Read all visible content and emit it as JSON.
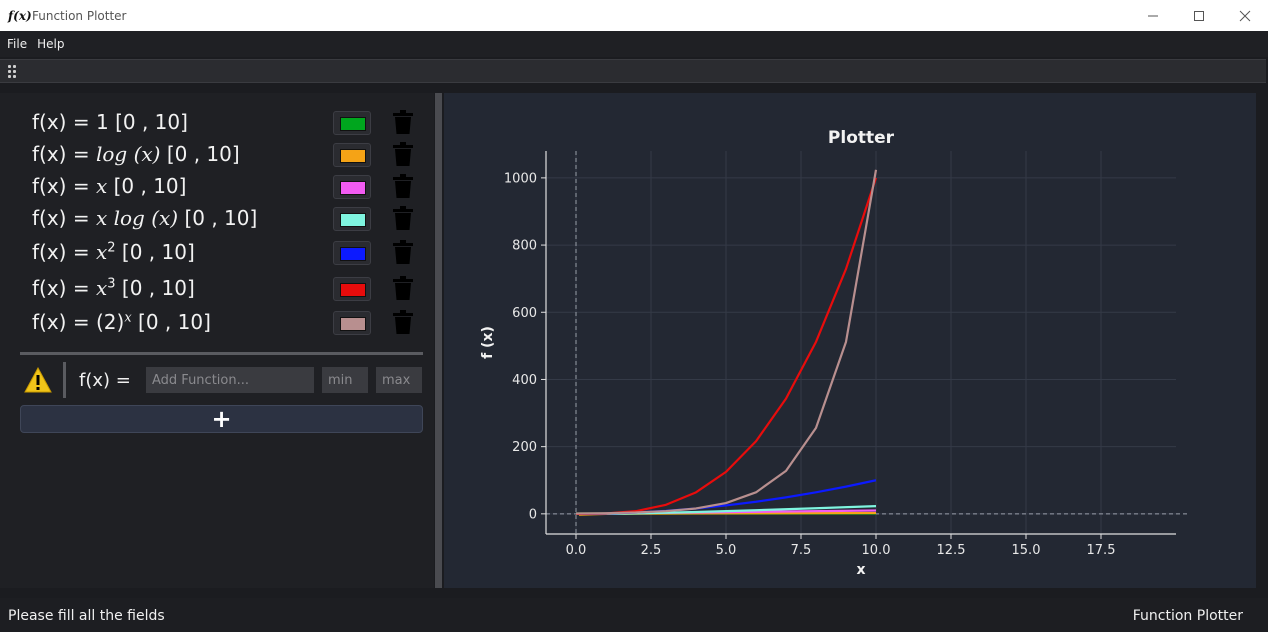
{
  "window": {
    "title": "Function Plotter",
    "icon_text": "f(x)",
    "controls": [
      "minimize-icon",
      "maximize-icon",
      "close-icon"
    ]
  },
  "menu": {
    "items": [
      "File",
      "Help"
    ]
  },
  "functions": [
    {
      "prefix": "f(x) = ",
      "expr": "1",
      "sup": "",
      "range": "[0 , 10]",
      "color": "#00a61e"
    },
    {
      "prefix": "f(x) = ",
      "expr": "log (x)",
      "sup": "",
      "range": "[0 , 10]",
      "color": "#f5a316"
    },
    {
      "prefix": "f(x) = ",
      "expr": "x",
      "sup": "",
      "range": "[0 , 10]",
      "color": "#f25bf2"
    },
    {
      "prefix": "f(x) = ",
      "expr": "x log (x)",
      "sup": "",
      "range": "[0 , 10]",
      "color": "#7ff5e0"
    },
    {
      "prefix": "f(x) = ",
      "expr": "x",
      "sup": "2",
      "range": "[0 , 10]",
      "color": "#0c1aff"
    },
    {
      "prefix": "f(x) = ",
      "expr": "x",
      "sup": "3",
      "range": "[0 , 10]",
      "color": "#e80c0c"
    },
    {
      "prefix": "f(x) = ",
      "expr": "(2)",
      "sup": "x",
      "range": "[0 , 10]",
      "color": "#b88f8f"
    }
  ],
  "input": {
    "prefix": "f(x) =",
    "function_placeholder": "Add Function...",
    "min_placeholder": "min",
    "max_placeholder": "max",
    "add_label": "+"
  },
  "status": {
    "message": "Please fill all the fields",
    "app_name": "Function Plotter"
  },
  "chart_data": {
    "type": "line",
    "title": "Plotter",
    "xlabel": "x",
    "ylabel": "f (x)",
    "xlim": [
      -1,
      20
    ],
    "ylim": [
      -60,
      1080
    ],
    "xticks": [
      0.0,
      2.5,
      5.0,
      7.5,
      10.0,
      12.5,
      15.0,
      17.5
    ],
    "xtick_labels": [
      "0.0",
      "2.5",
      "5.0",
      "7.5",
      "10.0",
      "12.5",
      "15.0",
      "17.5"
    ],
    "yticks": [
      0,
      200,
      400,
      600,
      800,
      1000
    ],
    "ytick_labels": [
      "0",
      "200",
      "400",
      "600",
      "800",
      "1000"
    ],
    "grid": true,
    "series": [
      {
        "color": "#00a61e",
        "x": [
          0,
          10
        ],
        "y": [
          1,
          1
        ]
      },
      {
        "color": "#f5a316",
        "x": [
          0.1,
          1,
          2,
          4,
          6,
          8,
          10
        ],
        "y": [
          -2.3,
          0,
          0.69,
          1.39,
          1.79,
          2.08,
          2.3
        ]
      },
      {
        "color": "#f25bf2",
        "x": [
          0,
          10
        ],
        "y": [
          0,
          10
        ]
      },
      {
        "color": "#7ff5e0",
        "x": [
          0.1,
          1,
          2,
          4,
          6,
          8,
          10
        ],
        "y": [
          -0.23,
          0,
          1.39,
          5.55,
          10.75,
          16.64,
          23.03
        ]
      },
      {
        "color": "#0c1aff",
        "x": [
          0,
          1,
          2,
          3,
          4,
          5,
          6,
          7,
          8,
          9,
          10
        ],
        "y": [
          0,
          1,
          4,
          9,
          16,
          25,
          36,
          49,
          64,
          81,
          100
        ]
      },
      {
        "color": "#e80c0c",
        "x": [
          0,
          1,
          2,
          3,
          4,
          5,
          6,
          7,
          8,
          9,
          10
        ],
        "y": [
          0,
          1,
          8,
          27,
          64,
          125,
          216,
          343,
          512,
          729,
          1000
        ]
      },
      {
        "color": "#b88f8f",
        "x": [
          0,
          1,
          2,
          3,
          4,
          5,
          6,
          7,
          8,
          9,
          10
        ],
        "y": [
          1,
          2,
          4,
          8,
          16,
          32,
          64,
          128,
          256,
          512,
          1024
        ]
      }
    ]
  }
}
